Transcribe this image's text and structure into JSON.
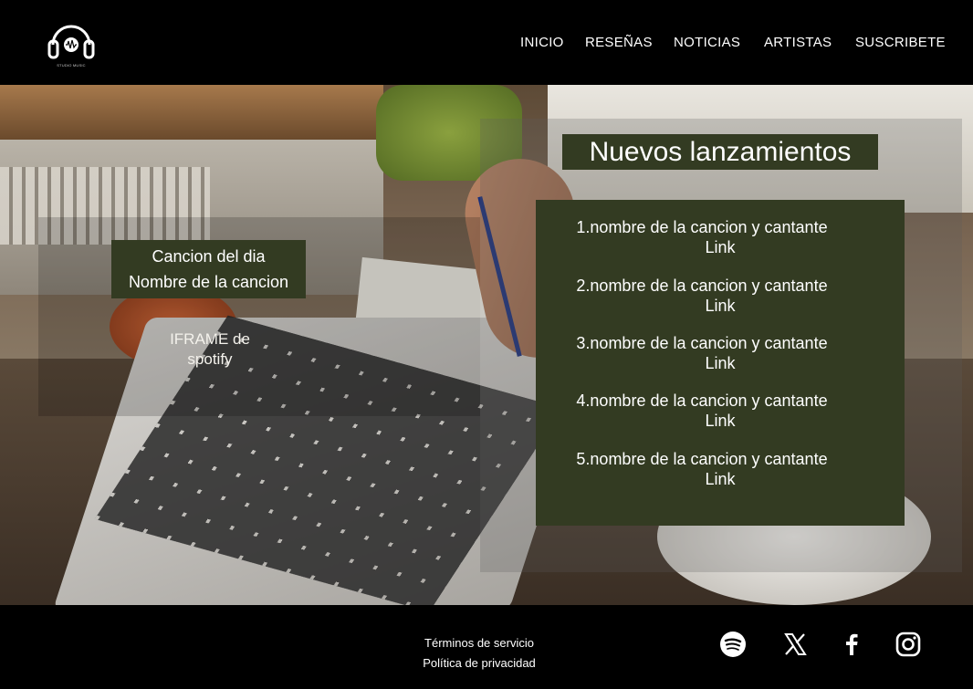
{
  "header": {
    "logo_text": "STUDIO MUSIC",
    "nav": [
      "INICIO",
      "RESEÑAS",
      "NOTICIAS",
      "ARTISTAS",
      "SUSCRIBETE"
    ]
  },
  "song_of_day": {
    "title": "Cancion del dia",
    "song": "Nombre de la cancion",
    "iframe_placeholder": "IFRAME de spotify"
  },
  "new_releases": {
    "title": "Nuevos lanzamientos",
    "items": [
      {
        "name": "1.nombre de la cancion y cantante",
        "link": "Link"
      },
      {
        "name": "2.nombre de la cancion y cantante",
        "link": "Link"
      },
      {
        "name": "3.nombre de la cancion y cantante",
        "link": "Link"
      },
      {
        "name": "4.nombre de la cancion y cantante",
        "link": "Link"
      },
      {
        "name": "5.nombre de la cancion y cantante",
        "link": "Link"
      }
    ]
  },
  "footer": {
    "terms": "Términos de servicio",
    "privacy": "Política de privacidad",
    "social_icons": [
      "spotify-icon",
      "x-icon",
      "facebook-icon",
      "instagram-icon"
    ]
  },
  "colors": {
    "background": "#000000",
    "panel": "#333b22",
    "text": "#ffffff"
  }
}
